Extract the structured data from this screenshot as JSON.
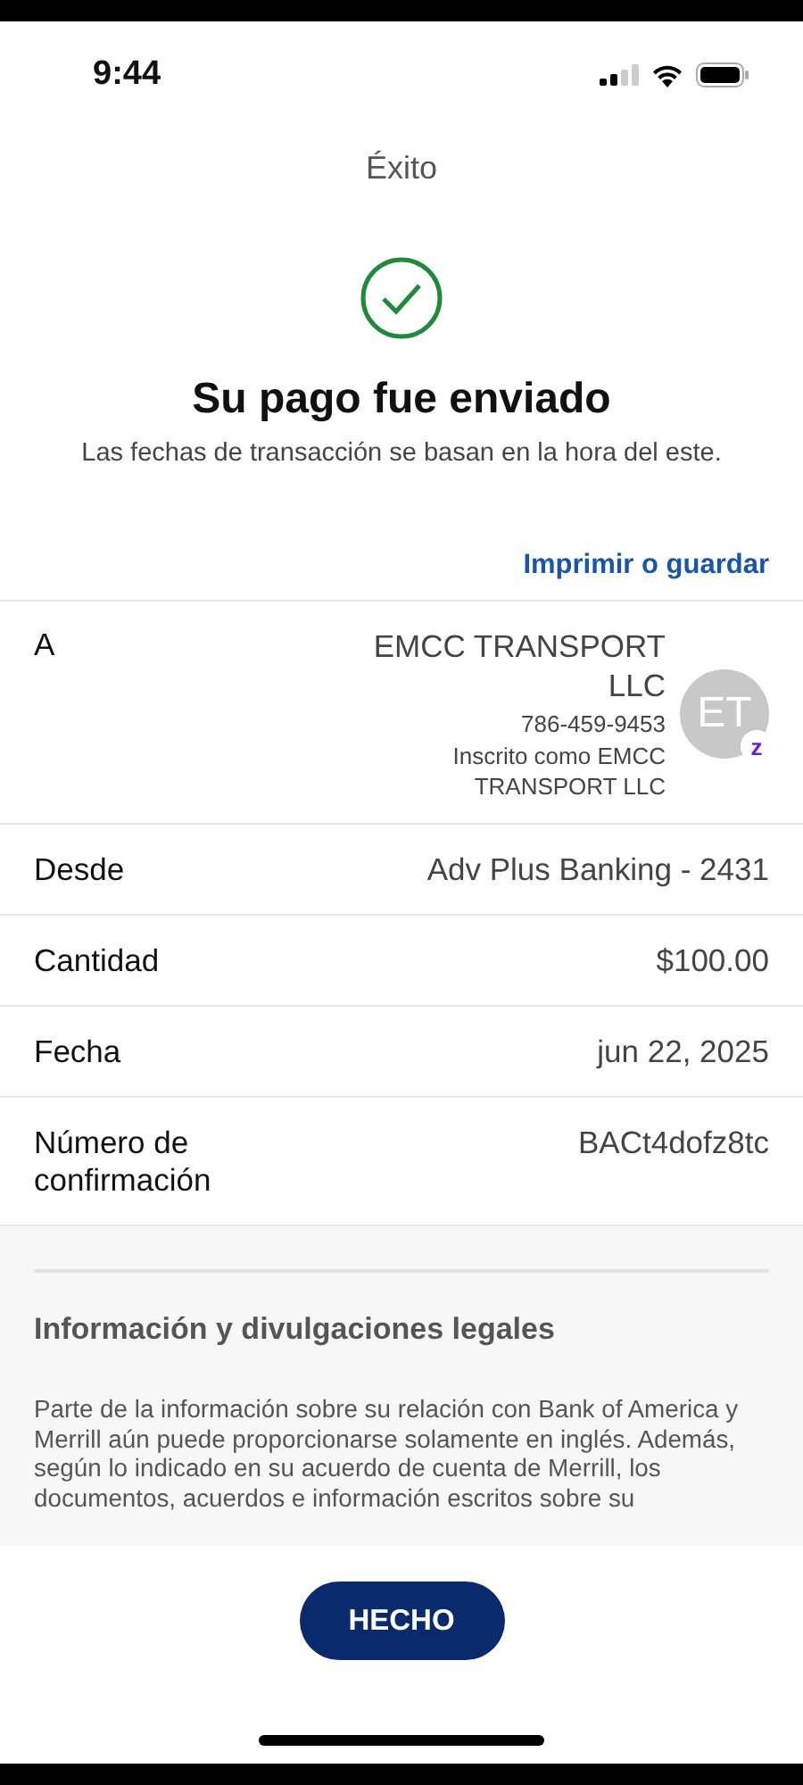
{
  "status_bar": {
    "time": "9:44"
  },
  "header": {
    "title": "Éxito"
  },
  "success": {
    "title": "Su pago fue enviado",
    "subtitle": "Las fechas de transacción se basan en la hora del este."
  },
  "print_link": "Imprimir o guardar",
  "recipient": {
    "label": "A",
    "name": "EMCC TRANSPORT LLC",
    "phone": "786-459-9453",
    "enrolled_as": "Inscrito como EMCC TRANSPORT LLC",
    "initials": "ET",
    "badge": "z"
  },
  "details": [
    {
      "label": "Desde",
      "value": "Adv Plus Banking - 2431"
    },
    {
      "label": "Cantidad",
      "value": "$100.00"
    },
    {
      "label": "Fecha",
      "value": "jun 22, 2025"
    },
    {
      "label": "Número de confirmación",
      "value": "BACt4dofz8tc"
    }
  ],
  "legal": {
    "title": "Información y divulgaciones legales",
    "text": "Parte de la información sobre su relación con Bank of America y Merrill aún puede proporcionarse solamente en inglés. Además, según lo indicado en su acuerdo de cuenta de Merrill, los documentos, acuerdos e información escritos sobre su"
  },
  "done_button": "HECHO"
}
